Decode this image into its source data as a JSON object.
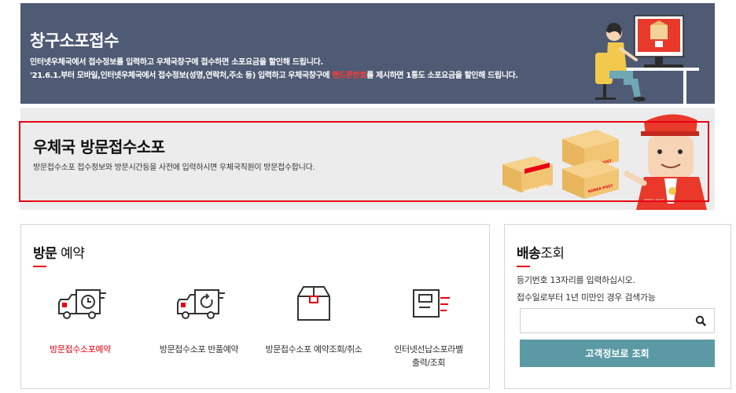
{
  "counter_banner": {
    "title": "창구소포접수",
    "line1": "인터넷우체국에서 접수정보를 입력하고 우체국창구에 접수하면 소포요금을 할인해 드립니다.",
    "line2_pre": "'21.6.1.부터 모바일,인터넷우체국에서 접수정보(성명,연락처,주소 등) 입력하고 우체국창구에 ",
    "line2_highlight": "핸드폰번호",
    "line2_post": "를 제시하면 1통도 소포요금을 할인해 드립니다.",
    "bg_color": "#4f5b74",
    "highlight_color": "#ff3b3b"
  },
  "visit_banner": {
    "title": "우체국 방문접수소포",
    "desc": "방문접수소포 접수정보와 방문시간등을 사전에 입력하시면 우체국직원이 방문접수합니다.",
    "box_label_1": "KOREA POST",
    "box_label_2": "KOREA POST",
    "box_label_3": "KOREA POST",
    "box_label_4": "KOREA POST",
    "accent_color": "#e60012"
  },
  "visit_card": {
    "heading_bold": "방문",
    "heading_light": " 예약",
    "services": [
      {
        "label": "방문접수소포예약",
        "icon": "truck-clock-icon"
      },
      {
        "label": "방문접수소포 반품예약",
        "icon": "truck-return-icon"
      },
      {
        "label": "방문접수소포 예약조회/취소",
        "icon": "parcel-box-icon"
      },
      {
        "label_line1": "인터넷선납소포라벨",
        "label_line2": "출력/조회",
        "icon": "label-print-icon"
      }
    ]
  },
  "tracking_card": {
    "heading_bold": "배송",
    "heading_light": "조회",
    "info1": "등기번호 13자리를 입력하십시오.",
    "info2": "접수일로부터 1년 미만인 경우 검색가능",
    "input_value": "",
    "input_placeholder": "",
    "lookup_button": "고객정보로 조회",
    "button_color": "#5b9aa4"
  }
}
